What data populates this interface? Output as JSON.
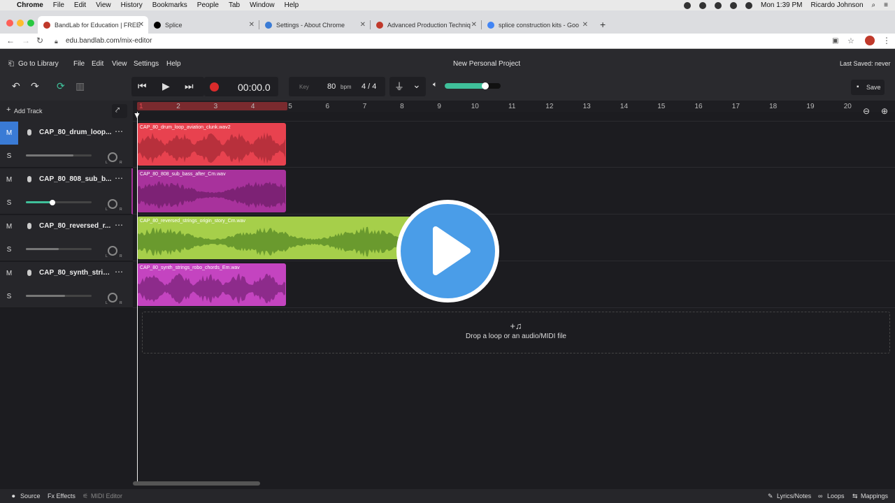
{
  "menubar": {
    "app": "Chrome",
    "items": [
      "File",
      "Edit",
      "View",
      "History",
      "Bookmarks",
      "People",
      "Tab",
      "Window",
      "Help"
    ],
    "clock": "Mon 1:39 PM",
    "user": "Ricardo Johnson"
  },
  "tabs": [
    {
      "title": "BandLab for Education | FREE",
      "favicon_color": "#c0392b"
    },
    {
      "title": "Splice",
      "favicon_color": "#000000"
    },
    {
      "title": "Settings - About Chrome",
      "favicon_color": "#3a7bd5"
    },
    {
      "title": "Advanced Production Techniq",
      "favicon_color": "#c0392b"
    },
    {
      "title": "splice construction kits - Goo",
      "favicon_color": "#4285f4"
    }
  ],
  "url": "edu.bandlab.com/mix-editor",
  "app": {
    "go_to_library": "Go to Library",
    "menus": [
      "File",
      "Edit",
      "View",
      "Settings",
      "Help"
    ],
    "project_title": "New Personal Project",
    "last_saved": "Last Saved: never",
    "save": "Save"
  },
  "transport": {
    "time": "00:00.0",
    "key_label": "Key",
    "bpm": "80",
    "bpm_unit": "bpm",
    "time_signature": "4 / 4",
    "master_volume": 0.72,
    "accent": "#3fc09a"
  },
  "timeline": {
    "add_track": "Add Track",
    "bars": [
      "1",
      "2",
      "3",
      "4",
      "5",
      "6",
      "7",
      "8",
      "9",
      "10",
      "11",
      "12",
      "13",
      "14",
      "15",
      "16",
      "17",
      "18",
      "19",
      "20"
    ],
    "loop_region_bars": [
      1,
      5
    ]
  },
  "tracks": [
    {
      "name": "CAP_80_drum_loop...",
      "mute_active": true,
      "volume": 0.72,
      "clip": {
        "label": "CAP_80_drum_loop_aviation_clunk.wav2",
        "color": "#e8424f",
        "wave": "#b8303c",
        "bars": 4
      }
    },
    {
      "name": "CAP_80_808_sub_b...",
      "mute_active": false,
      "volume": 0.4,
      "clip": {
        "label": "CAP_80_808_sub_bass_after_Cm.wav",
        "color": "#a8329c",
        "wave": "#7d2275",
        "bars": 4
      }
    },
    {
      "name": "CAP_80_reversed_r...",
      "mute_active": false,
      "volume": 0.5,
      "clip": {
        "label": "CAP_80_reversed_strings_origin_story_Cm.wav",
        "color": "#a6cf4a",
        "wave": "#6a9a2e",
        "bars": 8
      }
    },
    {
      "name": "CAP_80_synth_strin...",
      "mute_active": false,
      "volume": 0.6,
      "clip": {
        "label": "CAP_80_synth_strings_robo_chords_Em.wav",
        "color": "#c444c0",
        "wave": "#8d2b8b",
        "bars": 4
      }
    }
  ],
  "track_labels": {
    "mute": "M",
    "solo": "S",
    "pan_left": "L",
    "pan_right": "R"
  },
  "drop_zone": {
    "icon": "+♫",
    "text": "Drop a loop or an audio/MIDI file"
  },
  "bottom": {
    "source": "Source",
    "effects": "Fx Effects",
    "midi_editor": "MIDI Editor",
    "lyrics": "Lyrics/Notes",
    "loops": "Loops",
    "mappings": "Mappings"
  },
  "overlay": {
    "color": "#4a9de8"
  }
}
